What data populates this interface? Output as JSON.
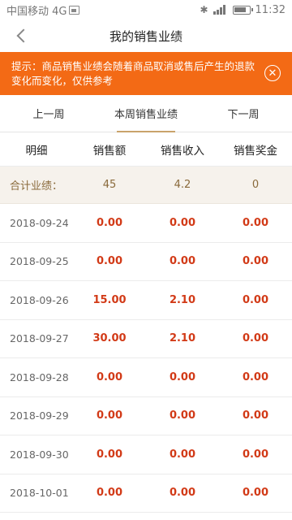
{
  "status_bar": {
    "carrier": "中国移动 4G",
    "time": "11:32",
    "network_label": "4G"
  },
  "nav": {
    "title": "我的销售业绩"
  },
  "notice": {
    "text": "提示：商品销售业绩会随着商品取消或售后产生的退款变化而变化，仅供参考",
    "close_glyph": "✕"
  },
  "tabs": [
    {
      "label": "上一周",
      "active": false
    },
    {
      "label": "本周销售业绩",
      "active": true
    },
    {
      "label": "下一周",
      "active": false
    }
  ],
  "columns": [
    "明细",
    "销售额",
    "销售收入",
    "销售奖金"
  ],
  "total": {
    "label": "合计业绩：",
    "sales": "45",
    "income": "4.2",
    "bonus": "0"
  },
  "rows": [
    {
      "date": "2018-09-24",
      "sales": "0.00",
      "income": "0.00",
      "bonus": "0.00"
    },
    {
      "date": "2018-09-25",
      "sales": "0.00",
      "income": "0.00",
      "bonus": "0.00"
    },
    {
      "date": "2018-09-26",
      "sales": "15.00",
      "income": "2.10",
      "bonus": "0.00"
    },
    {
      "date": "2018-09-27",
      "sales": "30.00",
      "income": "2.10",
      "bonus": "0.00"
    },
    {
      "date": "2018-09-28",
      "sales": "0.00",
      "income": "0.00",
      "bonus": "0.00"
    },
    {
      "date": "2018-09-29",
      "sales": "0.00",
      "income": "0.00",
      "bonus": "0.00"
    },
    {
      "date": "2018-09-30",
      "sales": "0.00",
      "income": "0.00",
      "bonus": "0.00"
    },
    {
      "date": "2018-10-01",
      "sales": "0.00",
      "income": "0.00",
      "bonus": "0.00"
    }
  ],
  "colors": {
    "notice_bg": "#f36a15",
    "accent_gold": "#c9a36b",
    "value_red": "#d23a17",
    "total_bg": "#f6f2ec"
  }
}
